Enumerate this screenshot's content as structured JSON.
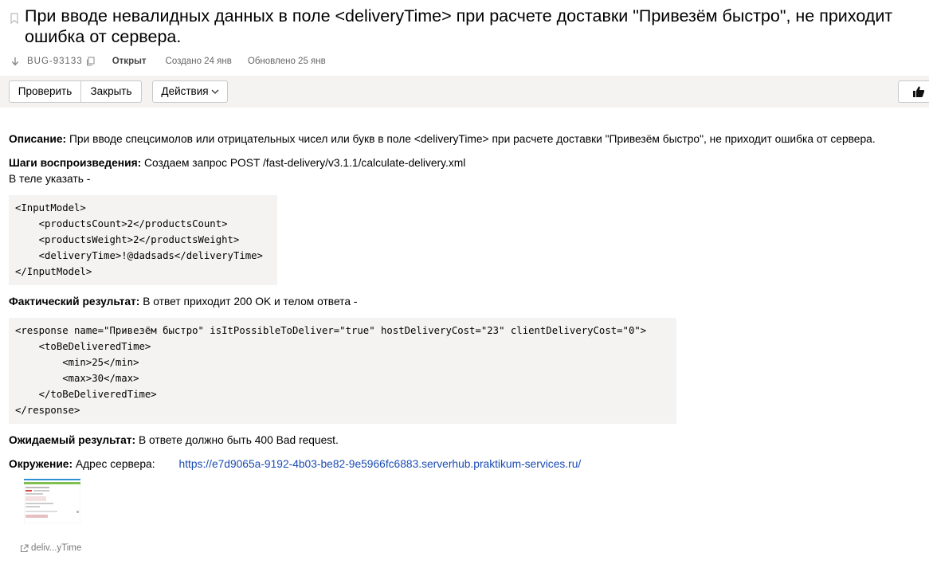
{
  "issue": {
    "title": "При вводе невалидных данных в поле <deliveryTime> при расчете доставки \"Привезём быстро\", не приходит ошибка от сервера.",
    "key": "BUG-93133",
    "status": "Открыт",
    "created": "Создано 24 янв",
    "updated": "Обновлено 25 янв"
  },
  "toolbar": {
    "check_label": "Проверить",
    "close_label": "Закрыть",
    "actions_label": "Действия"
  },
  "description": {
    "label": "Описание:",
    "text": " При вводе спецсимолов или отрицательных чисел или букв в поле <deliveryTime> при расчете доставки \"Привезём быстро\", не приходит ошибка от сервера."
  },
  "steps": {
    "label": "Шаги воспроизведения:",
    "text": " Создаем запрос POST /fast-delivery/v3.1.1/calculate-delivery.xml",
    "body_text": "В теле указать -",
    "code": "<InputModel>\n    <productsCount>2</productsCount>\n    <productsWeight>2</productsWeight>\n    <deliveryTime>!@dadsads</deliveryTime>\n</InputModel>"
  },
  "actual": {
    "label": "Фактический результат:",
    "text": " В ответ приходит 200 OK и телом ответа -",
    "code": "<response name=\"Привезём быстро\" isItPossibleToDeliver=\"true\" hostDeliveryCost=\"23\" clientDeliveryCost=\"0\">\n    <toBeDeliveredTime>\n        <min>25</min>\n        <max>30</max>\n    </toBeDeliveredTime>\n</response>"
  },
  "expected": {
    "label": "Ожидаемый результат:",
    "text": " В ответе должно быть 400 Bad request."
  },
  "environment": {
    "label": "Окружение:",
    "text": " Адрес сервера:",
    "link": "https://e7d9065a-9192-4b03-be82-9e5966fc6883.serverhub.praktikum-services.ru/"
  },
  "attachment": {
    "name": "deliv...yTime"
  },
  "icons": {
    "bookmark": "bookmark-icon",
    "arrow": "arrow-down-icon",
    "copy": "copy-icon",
    "chevron": "chevron-down-icon",
    "like": "thumbs-up-icon",
    "external": "external-link-icon"
  },
  "colors": {
    "link": "#1a4bb3",
    "toolbar_bg": "#f4f3f2",
    "code_bg": "#f4f3f2"
  }
}
